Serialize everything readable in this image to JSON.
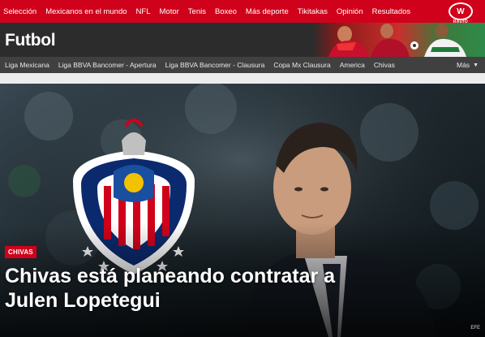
{
  "topnav": {
    "items": [
      "Selección",
      "Mexicanos en el mundo",
      "NFL",
      "Motor",
      "Tenis",
      "Boxeo",
      "Más deporte",
      "Tikitakas",
      "Opinión",
      "Resultados"
    ],
    "logo_text": "W",
    "logo_sub": "RADIO"
  },
  "section": {
    "title": "Futbol"
  },
  "subnav": {
    "items": [
      "Liga Mexicana",
      "Liga BBVA Bancomer - Apertura",
      "Liga BBVA Bancomer - Clausura",
      "Copa Mx Clausura",
      "America",
      "Chivas"
    ],
    "more_label": "Más"
  },
  "hero": {
    "badge": "CHIVAS",
    "headline": "Chivas está planeando contratar a Julen Lopetegui",
    "credit": "EFE"
  },
  "colors": {
    "brand_red": "#d0021b",
    "header_dark": "#2c2c2c",
    "subnav_gray": "#404040"
  }
}
